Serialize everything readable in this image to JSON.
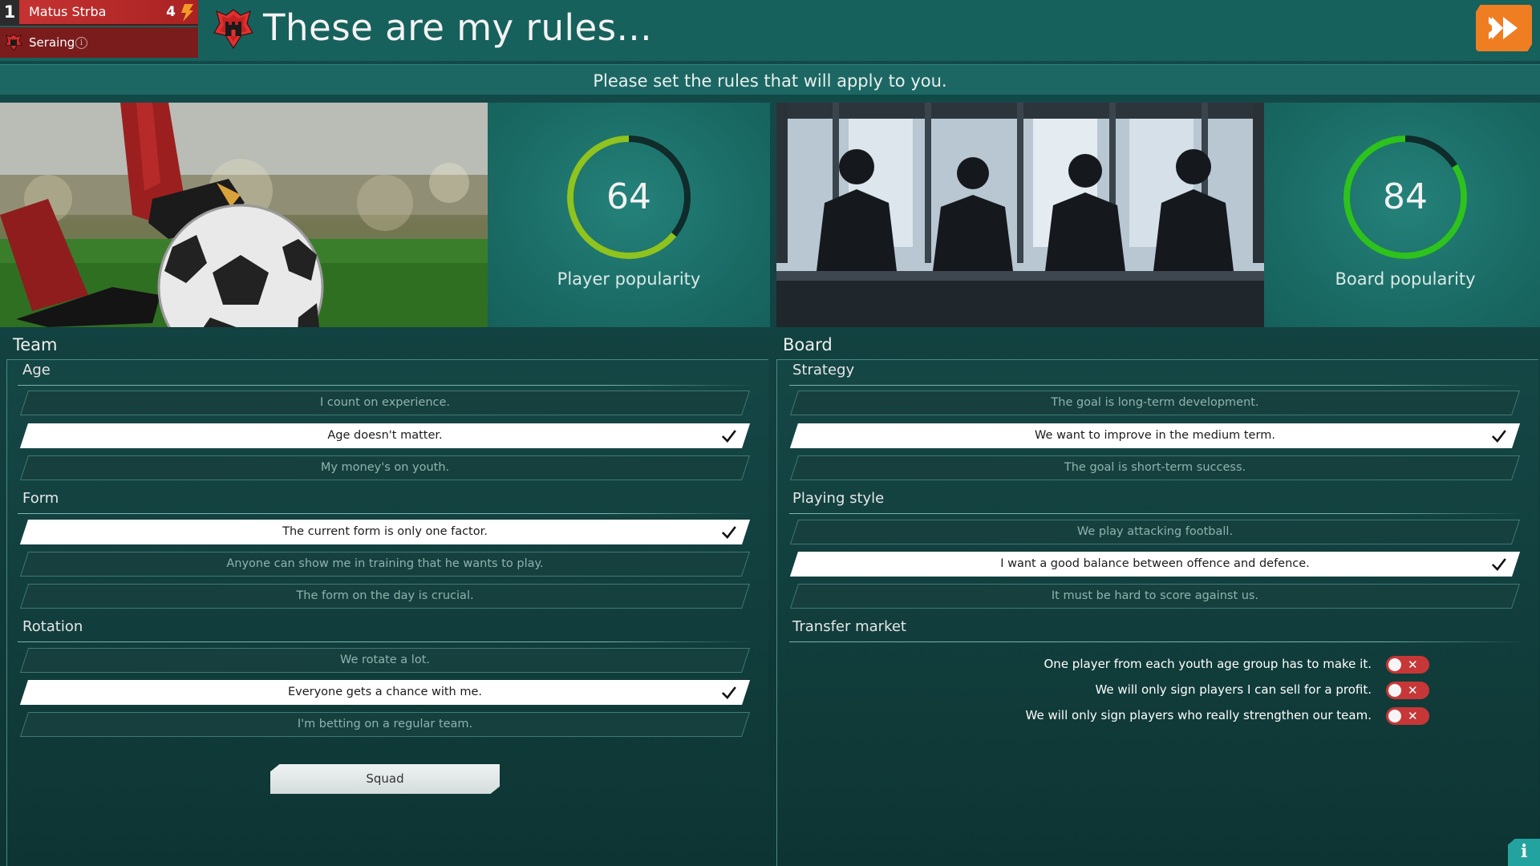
{
  "manager": {
    "rank": "1",
    "name": "Matus Strba",
    "level": "4",
    "club": "Seraing",
    "level_icon": "bolt-icon"
  },
  "header": {
    "title": "These are my rules...",
    "subtitle": "Please set the rules that will apply to you.",
    "continue_icon": "fast-forward-icon",
    "accent_color": "#ef7e22"
  },
  "popularity": {
    "player": {
      "value": "64",
      "label": "Player popularity",
      "fraction": 0.64,
      "color": "#8fc31f"
    },
    "board": {
      "value": "84",
      "label": "Board popularity",
      "fraction": 0.84,
      "color": "#2ec21f"
    }
  },
  "team": {
    "title": "Team",
    "groups": [
      {
        "title": "Age",
        "options": [
          {
            "label": "I count on experience.",
            "selected": false
          },
          {
            "label": "Age doesn't matter.",
            "selected": true
          },
          {
            "label": "My money's on youth.",
            "selected": false
          }
        ]
      },
      {
        "title": "Form",
        "options": [
          {
            "label": "The current form is only one factor.",
            "selected": true
          },
          {
            "label": "Anyone can show me in training that he wants to play.",
            "selected": false
          },
          {
            "label": "The form on the day is crucial.",
            "selected": false
          }
        ]
      },
      {
        "title": "Rotation",
        "options": [
          {
            "label": "We rotate a lot.",
            "selected": false
          },
          {
            "label": "Everyone gets a chance with me.",
            "selected": true
          },
          {
            "label": "I'm betting on a regular team.",
            "selected": false
          }
        ]
      }
    ],
    "squad_button": "Squad"
  },
  "board": {
    "title": "Board",
    "groups": [
      {
        "title": "Strategy",
        "options": [
          {
            "label": "The goal is long-term development.",
            "selected": false
          },
          {
            "label": "We want to improve in the medium term.",
            "selected": true
          },
          {
            "label": "The goal is short-term success.",
            "selected": false
          }
        ]
      },
      {
        "title": "Playing style",
        "options": [
          {
            "label": "We play attacking football.",
            "selected": false
          },
          {
            "label": "I want a good balance between offence and defence.",
            "selected": true
          },
          {
            "label": "It must be hard to score against us.",
            "selected": false
          }
        ]
      }
    ],
    "transfer": {
      "title": "Transfer market",
      "toggles": [
        {
          "label": "One player from each youth age group has to make it.",
          "on": false
        },
        {
          "label": "We will only sign players I can sell for a profit.",
          "on": false
        },
        {
          "label": "We will only sign players who really strengthen our team.",
          "on": false
        }
      ]
    }
  },
  "help_icon": "info-icon"
}
